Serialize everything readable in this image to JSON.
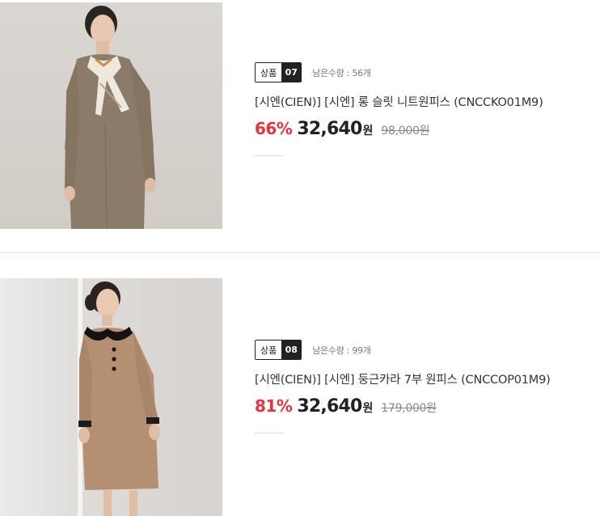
{
  "products": [
    {
      "badge_label": "상품",
      "badge_number": "07",
      "stock_text": "남은수량 : 56개",
      "title": "[시엔(CIEN)] [시엔] 롱 슬릿 니트원피스 (CNCCKO01M9)",
      "discount": "66%",
      "price": "32,640",
      "price_unit": "원",
      "original_price": "98,000",
      "original_unit": "원",
      "image": "model-knit-dress-with-scarf"
    },
    {
      "badge_label": "상품",
      "badge_number": "08",
      "stock_text": "남은수량 : 99개",
      "title": "[시엔(CIEN)] [시엔] 둥근카라 7부 원피스 (CNCCOP01M9)",
      "discount": "81%",
      "price": "32,640",
      "price_unit": "원",
      "original_price": "179,000",
      "original_unit": "원",
      "image": "model-collar-dress"
    }
  ],
  "colors": {
    "discount": "#e8333c",
    "badge_dark": "#222222",
    "divider": "#e6e6e6"
  }
}
